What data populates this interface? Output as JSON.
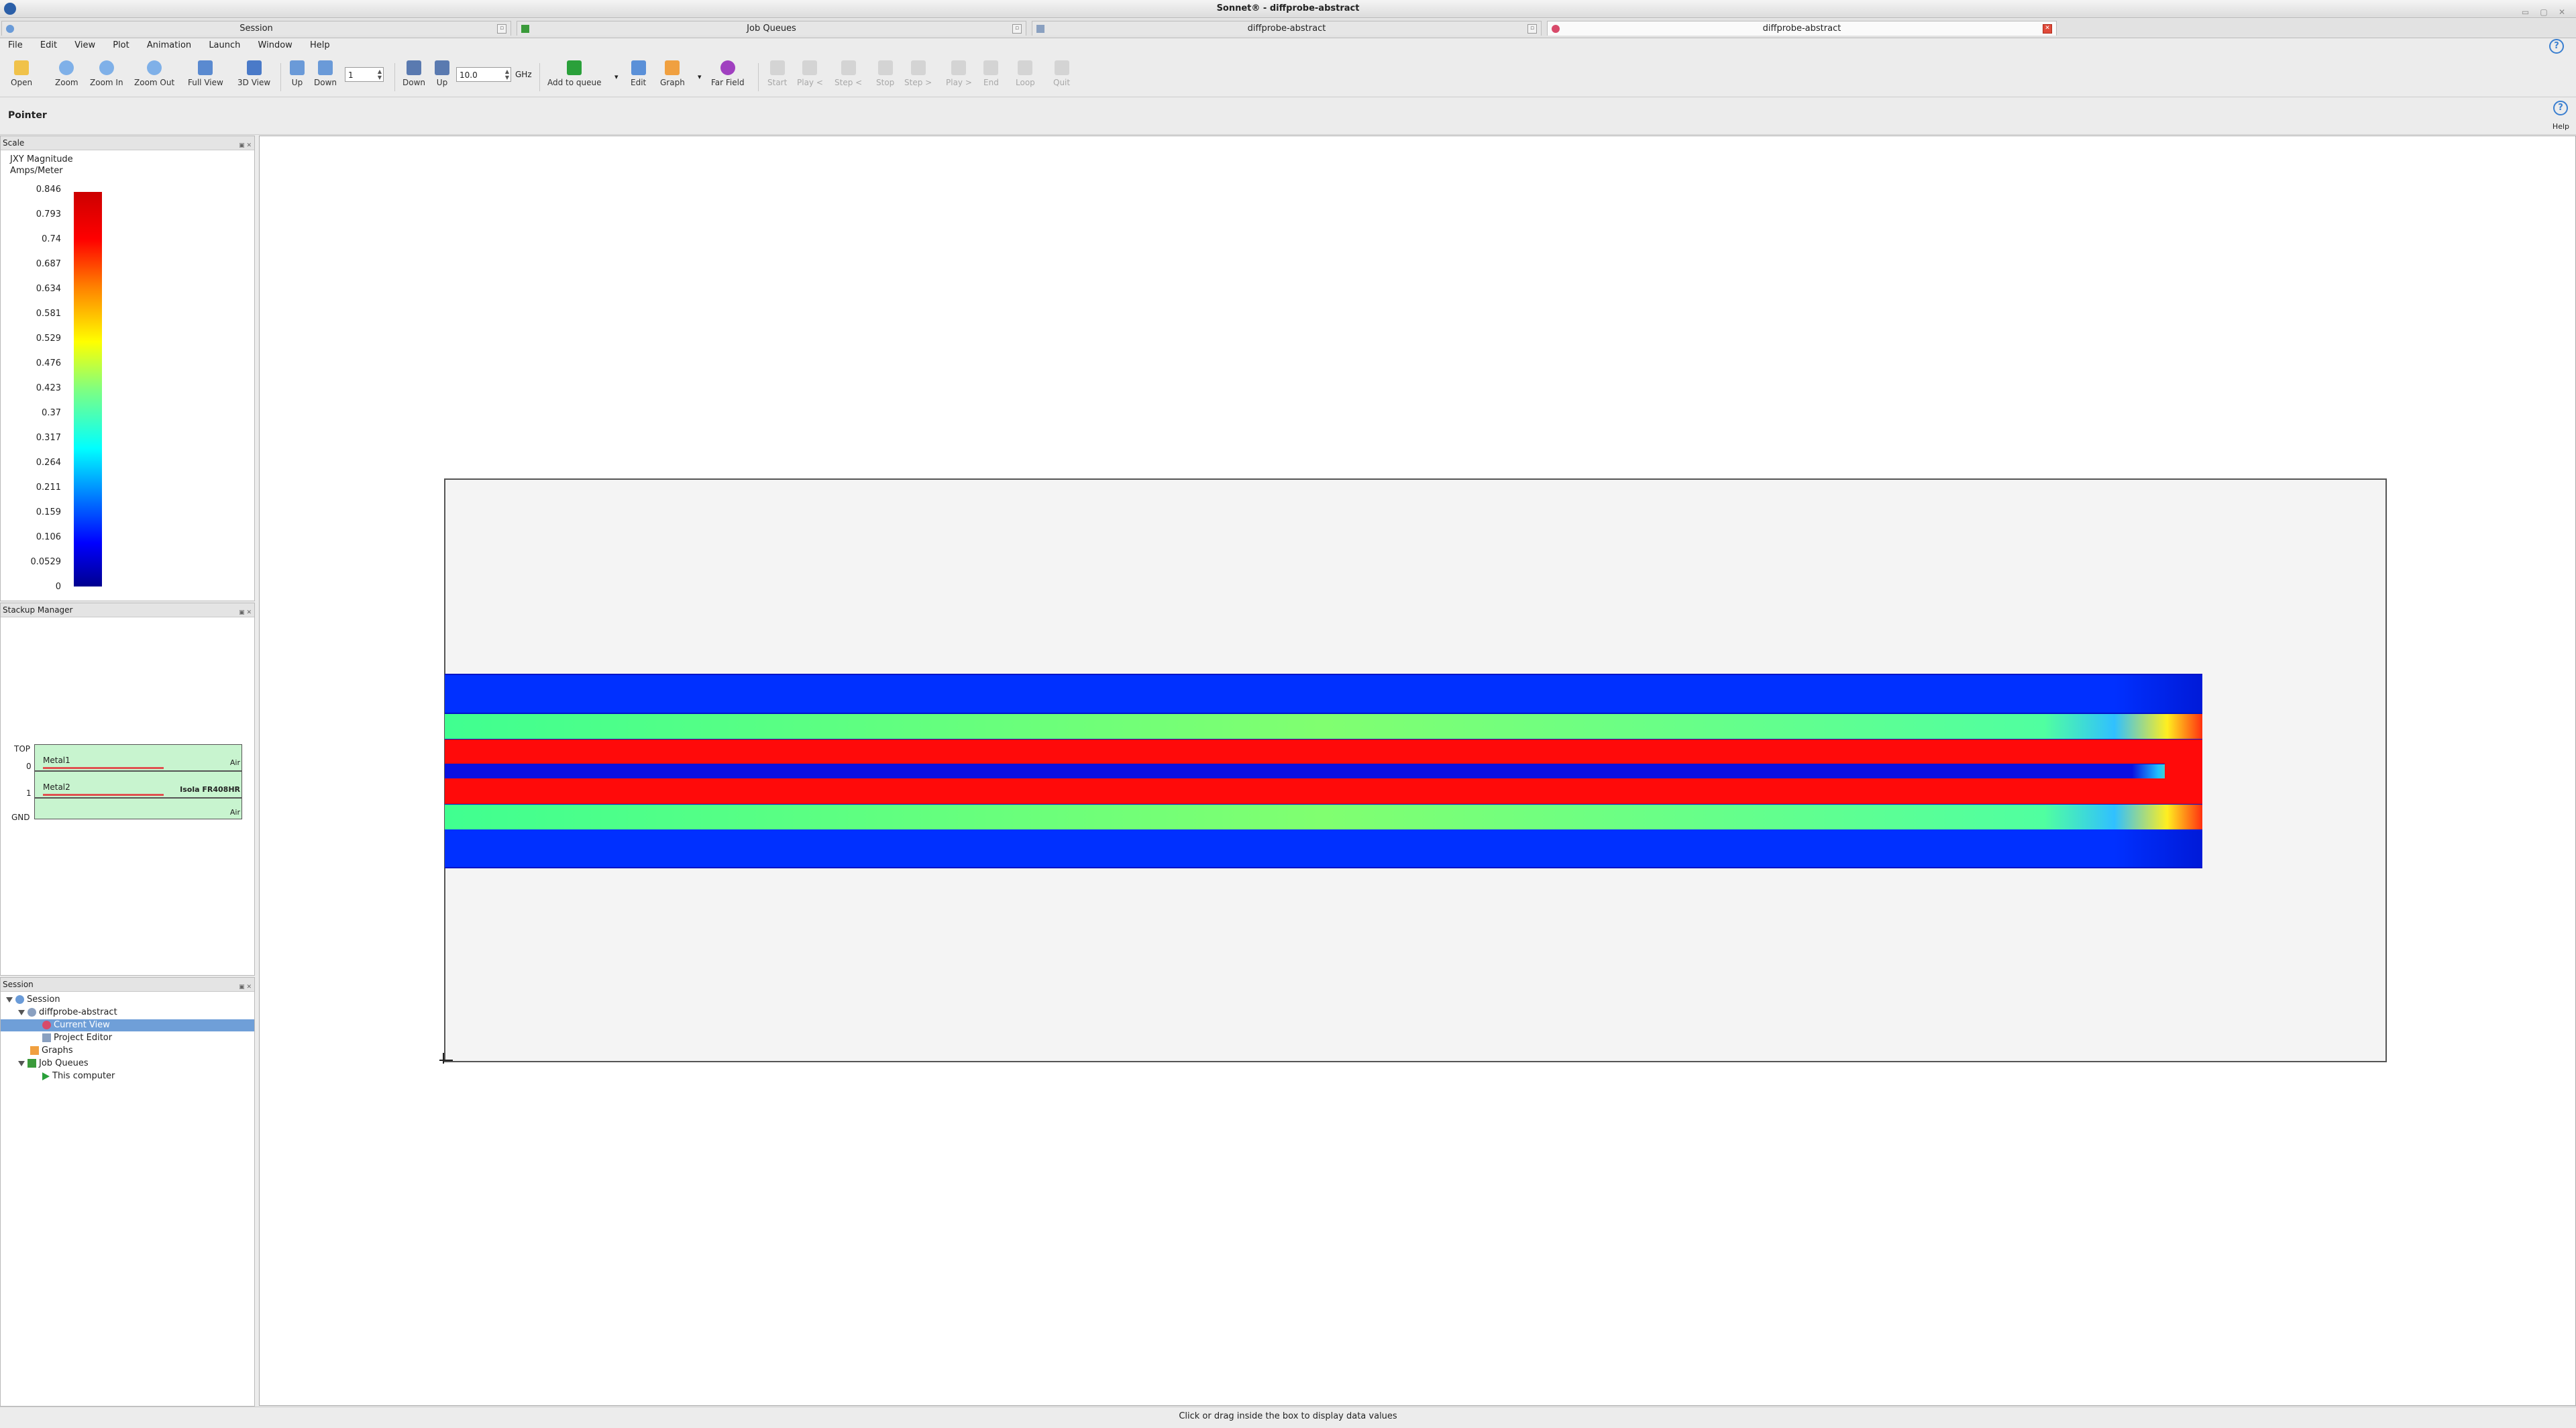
{
  "window": {
    "title": "Sonnet® - diffprobe-abstract"
  },
  "tabs": [
    {
      "label": "Session"
    },
    {
      "label": "Job Queues"
    },
    {
      "label": "diffprobe-abstract"
    },
    {
      "label": "diffprobe-abstract"
    }
  ],
  "menu": [
    "File",
    "Edit",
    "View",
    "Plot",
    "Animation",
    "Launch",
    "Window",
    "Help"
  ],
  "toolbar": {
    "open": "Open",
    "zoom": "Zoom",
    "zoom_in": "Zoom In",
    "zoom_out": "Zoom Out",
    "full_view": "Full View",
    "view_3d": "3D View",
    "up": "Up",
    "down": "Down",
    "level_value": "1",
    "down2": "Down",
    "up2": "Up",
    "freq_value": "10.0",
    "freq_unit": "GHz",
    "add_to_queue": "Add to queue",
    "edit": "Edit",
    "graph": "Graph",
    "far_field": "Far Field",
    "start": "Start",
    "play_back": "Play <",
    "step_back": "Step <",
    "stop": "Stop",
    "step_fwd": "Step >",
    "play_fwd": "Play >",
    "end": "End",
    "loop": "Loop",
    "quit": "Quit"
  },
  "pointer_bar": {
    "label": "Pointer",
    "help": "Help"
  },
  "scale_panel": {
    "title": "Scale",
    "quantity": "JXY Magnitude",
    "unit": "Amps/Meter",
    "ticks": [
      "0.846",
      "0.793",
      "0.74",
      "0.687",
      "0.634",
      "0.581",
      "0.529",
      "0.476",
      "0.423",
      "0.37",
      "0.317",
      "0.264",
      "0.211",
      "0.159",
      "0.106",
      "0.0529",
      "0"
    ]
  },
  "stackup_panel": {
    "title": "Stackup Manager",
    "top_label": "TOP",
    "zero_label": "0",
    "one_label": "1",
    "gnd_label": "GND",
    "metal1": "Metal1",
    "metal2": "Metal2",
    "air_top": "Air",
    "dielectric": "Isola FR408HR",
    "air_bottom": "Air"
  },
  "session_panel": {
    "title": "Session",
    "items": [
      "Session",
      "diffprobe-abstract",
      "Current View",
      "Project Editor",
      "Graphs",
      "Job Queues",
      "This computer"
    ]
  },
  "colors": {
    "accent": "#4a84c8",
    "selected_row": "#6f9fd8"
  },
  "status": {
    "message": "Click or drag inside the box to display data values"
  }
}
